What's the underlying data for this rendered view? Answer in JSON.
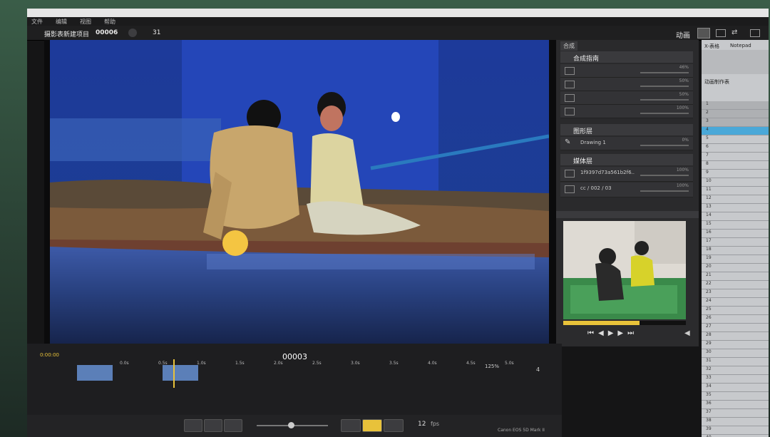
{
  "menubar": {
    "items": [
      "文件",
      "编辑",
      "视图",
      "帮助"
    ]
  },
  "toolbar": {
    "project_label": "摄影表新建项目",
    "frame_counter": "00006",
    "frame_total": "31",
    "mode_label": "动画"
  },
  "layers_panel": {
    "tab_label": "合成",
    "composite_header": "合成指南",
    "composite_items": [
      {
        "name": "",
        "pct": "46%"
      },
      {
        "name": "",
        "pct": "50%"
      },
      {
        "name": "",
        "pct": "50%"
      },
      {
        "name": "",
        "pct": "100%"
      }
    ],
    "drawing_header": "图形层",
    "drawing_item": {
      "name": "Drawing 1",
      "pct": "0%"
    },
    "media_header": "媒体层",
    "media_items": [
      {
        "name": "1f9397d73a561b2f6..",
        "pct": "100%"
      },
      {
        "name": "cc / 002 / 03",
        "pct": "100%"
      }
    ]
  },
  "sheet": {
    "tabs": [
      "X-表格",
      "Notepad"
    ],
    "header": "动画制作表",
    "rows": [
      "1",
      "2",
      "3",
      "4",
      "5",
      "6",
      "7",
      "8",
      "9",
      "10",
      "11",
      "12",
      "13",
      "14",
      "15",
      "16",
      "17",
      "18",
      "19",
      "20",
      "21",
      "22",
      "23",
      "24",
      "25",
      "26",
      "27",
      "28",
      "29",
      "30",
      "31",
      "32",
      "33",
      "34",
      "35",
      "36",
      "37",
      "38",
      "39",
      "40",
      "41"
    ]
  },
  "timeline": {
    "track_label": "0:00:00",
    "current_frame": "00003",
    "ticks": [
      "0.0s",
      "0.5s",
      "1.0s",
      "1.5s",
      "2.0s",
      "2.5s",
      "3.0s",
      "3.5s",
      "4.0s",
      "4.5s",
      "5.0s"
    ],
    "zoom": "125%",
    "fps_label": "12",
    "fps_unit": "fps",
    "frame_ctrl": "4"
  },
  "monitor": {
    "brand": "Canon EOS 5D Mark II"
  },
  "colors": {
    "accent": "#e8c23a",
    "selection": "#4aa8d8"
  }
}
